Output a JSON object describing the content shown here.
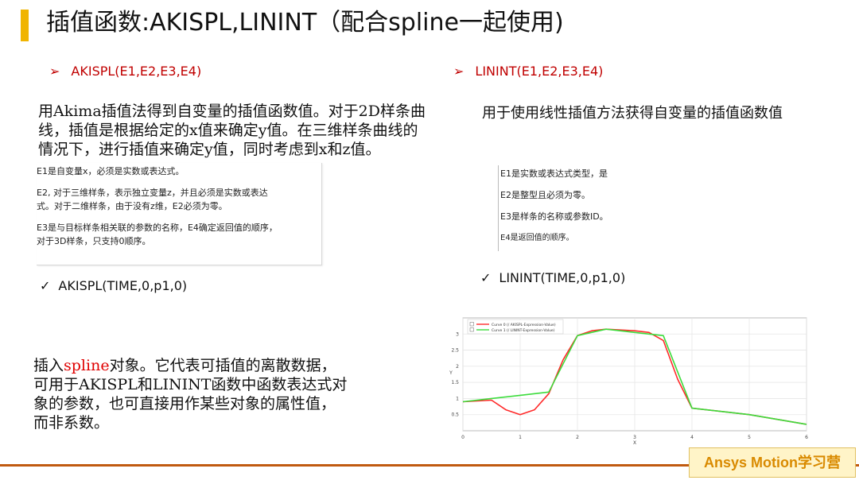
{
  "title": "插值函数:AKISPL,LININT（配合spline一起使用)",
  "left": {
    "heading_arrow": "➢",
    "heading": "AKISPL(E1,E2,E3,E4)",
    "para_lines": [
      "用Akima插值法得到自变量的插值函数值。对于2D样条曲",
      "线，插值是根据给定的x值来确定y值。在三维样条曲线的",
      "情况下，进行插值来确定y值，同时考虑到x和z值。"
    ],
    "panel": [
      "E1是自变量x，必须是实数或表达式。",
      "E2, 对于三维样条，表示独立变量z，并且必须是实数或表达",
      "式。对于二维样条，由于没有z维，E2必须为零。",
      "E3是与目标样条相关联的参数的名称，E4确定返回值的顺序，",
      "对于3D样条，只支持0顺序。"
    ],
    "check_mark": "✓",
    "example": "AKISPL(TIME,0,p1,0)",
    "bottom_lines": {
      "l1_pre": "插入",
      "l1_red": "spline",
      "l1_post": "对象。它代表可插值的离散数据，",
      "l2": "可用于AKISPL和LININT函数中函数表达式对",
      "l3": "象的参数，也可直接用作某些对象的属性值，",
      "l4": "而非系数。"
    }
  },
  "right": {
    "heading_arrow": "➢",
    "heading": "LININT(E1,E2,E3,E4)",
    "para": "用于使用线性插值方法获得自变量的插值函数值",
    "panel": [
      "E1是实数或表达式类型，是",
      "E2是整型且必须为零。",
      "E3是样条的名称或参数ID。",
      "E4是返回值的顺序。"
    ],
    "check_mark": "✓",
    "example": "LININT(TIME,0,p1,0)"
  },
  "chart_data": {
    "type": "line",
    "series": [
      {
        "name": "Curve 0 (/ AKISPL-Expression-Value)",
        "color": "#ff2a2a",
        "x": [
          0,
          0.5,
          0.75,
          1.0,
          1.25,
          1.5,
          1.75,
          2.0,
          2.25,
          2.5,
          3.0,
          3.25,
          3.5,
          3.75,
          4.0,
          5.0,
          6.0
        ],
        "y": [
          0.9,
          0.95,
          0.65,
          0.5,
          0.65,
          1.15,
          2.2,
          2.95,
          3.1,
          3.15,
          3.1,
          3.05,
          2.8,
          1.6,
          0.7,
          0.5,
          0.2
        ]
      },
      {
        "name": "Curve 1 (/ LININT-Expression-Value)",
        "color": "#3cdc3c",
        "x": [
          0,
          0.5,
          1.0,
          1.5,
          2.0,
          2.5,
          3.0,
          3.5,
          4.0,
          5.0,
          6.0
        ],
        "y": [
          0.9,
          1.0,
          1.1,
          1.2,
          2.95,
          3.15,
          3.05,
          2.95,
          0.7,
          0.5,
          0.2
        ]
      }
    ],
    "xticks": [
      "0",
      "1",
      "2",
      "3",
      "4",
      "5",
      "6"
    ],
    "yticks": [
      "0.5",
      "1",
      "1.5",
      "2",
      "2.5",
      "3"
    ],
    "xlabel": "X",
    "ylabel": "Y",
    "xlim": [
      0,
      6
    ],
    "ylim": [
      0,
      3.5
    ],
    "legend": "top-left",
    "grid": true
  },
  "footer": {
    "badge": "Ansys Motion学习营",
    "line_color": "#c05a10",
    "accent": "#f0b400"
  }
}
